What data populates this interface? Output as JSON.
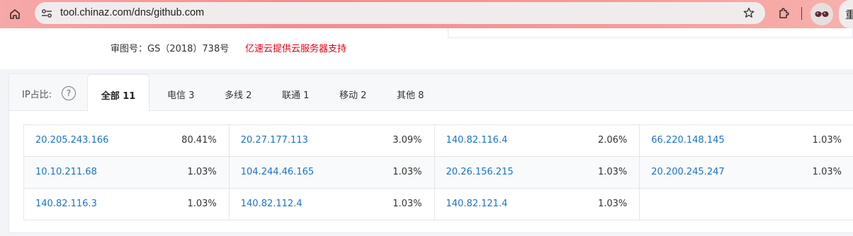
{
  "browser": {
    "url": "tool.chinaz.com/dns/github.com",
    "relaunch_label": "重"
  },
  "footer": {
    "review_number": "审图号：GS（2018）738号",
    "support_text": "亿速云提供云服务器支持"
  },
  "panel": {
    "ip_share_label": "IP占比:",
    "help_icon": "question-circle-icon",
    "tabs": [
      {
        "label": "全部 11",
        "active": true
      },
      {
        "label": "电信 3"
      },
      {
        "label": "多线 2"
      },
      {
        "label": "联通 1"
      },
      {
        "label": "移动 2"
      },
      {
        "label": "其他 8"
      }
    ],
    "rows": [
      [
        {
          "ip": "20.205.243.166",
          "pct": "80.41%"
        },
        {
          "ip": "20.27.177.113",
          "pct": "3.09%"
        },
        {
          "ip": "140.82.116.4",
          "pct": "2.06%"
        },
        {
          "ip": "66.220.148.145",
          "pct": "1.03%"
        }
      ],
      [
        {
          "ip": "10.10.211.68",
          "pct": "1.03%"
        },
        {
          "ip": "104.244.46.165",
          "pct": "1.03%"
        },
        {
          "ip": "20.26.156.215",
          "pct": "1.03%"
        },
        {
          "ip": "20.200.245.247",
          "pct": "1.03%"
        }
      ],
      [
        {
          "ip": "140.82.116.3",
          "pct": "1.03%"
        },
        {
          "ip": "140.82.112.4",
          "pct": "1.03%"
        },
        {
          "ip": "140.82.121.4",
          "pct": "1.03%"
        },
        {
          "ip": "",
          "pct": ""
        }
      ]
    ]
  },
  "colors": {
    "link": "#1a73c8",
    "support_red": "#e60012",
    "toolbar_pink": "#f28d8f"
  }
}
